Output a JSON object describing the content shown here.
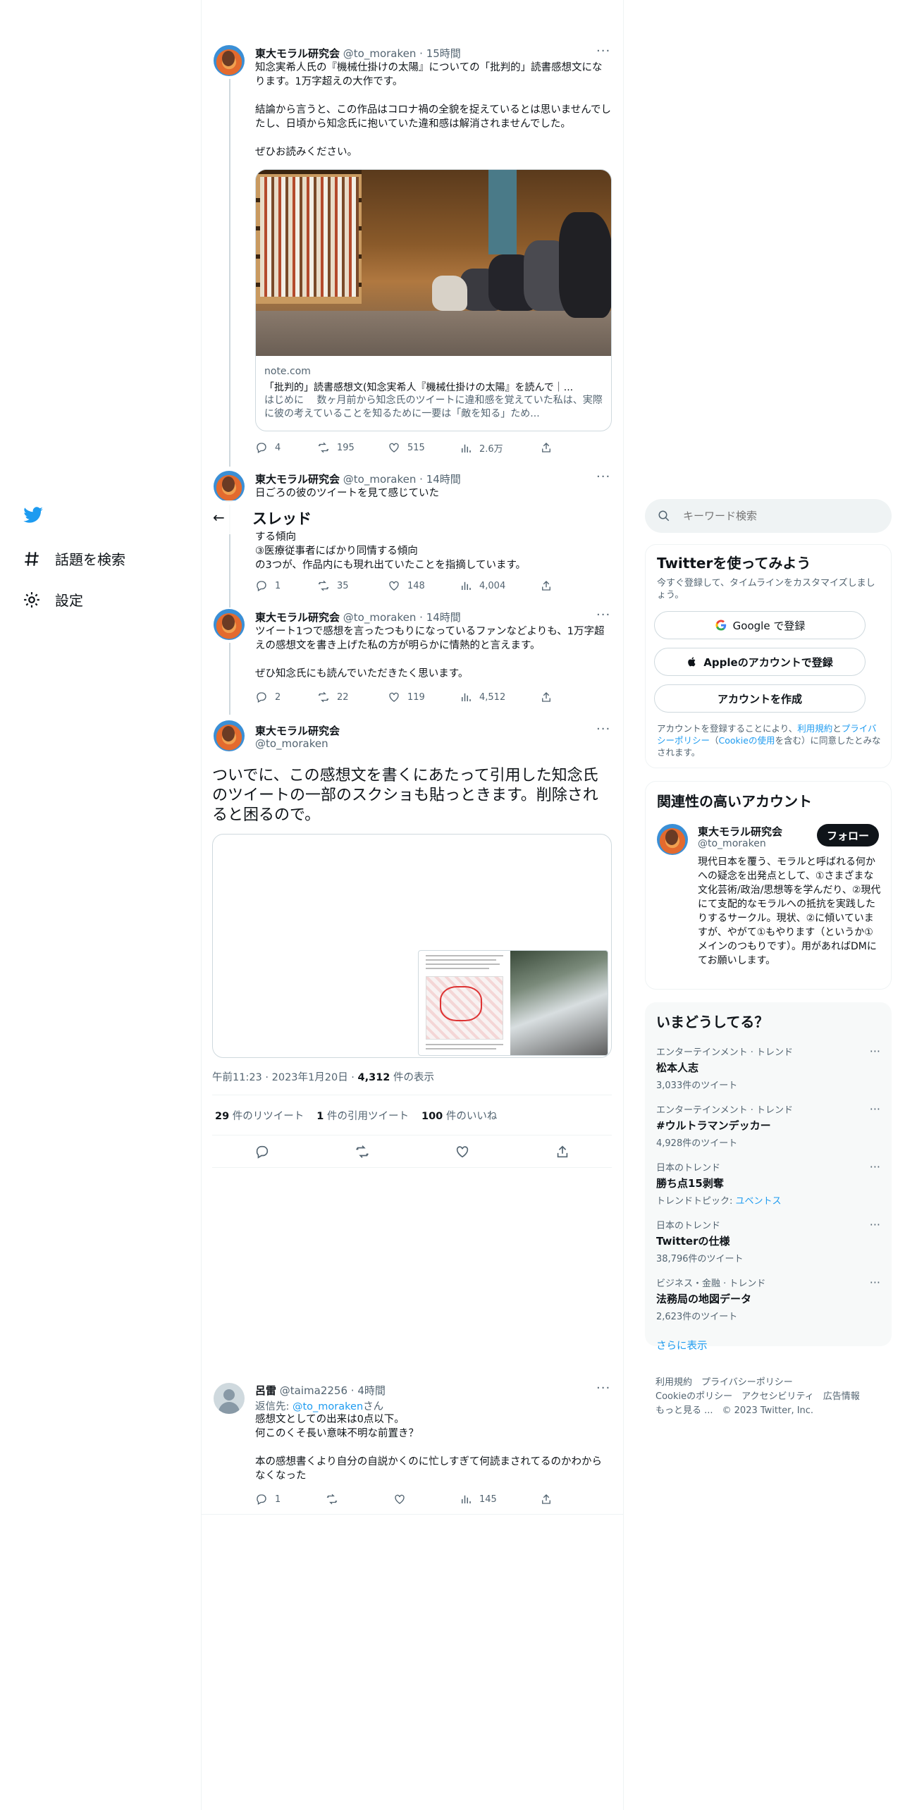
{
  "nav": {
    "explore": "話題を検索",
    "settings": "設定"
  },
  "topbar": {
    "back": "←",
    "title": "スレッド"
  },
  "tweets": [
    {
      "name": "東大モラル研究会",
      "handle": "@to_moraken",
      "time": "15時間",
      "text": "知念実希人氏の『機械仕掛けの太陽』についての「批判的」読書感想文になります。1万字超えの大作です。\n\n結論から言うと、この作品はコロナ禍の全貌を捉えているとは思いませんでしたし、日頃から知念氏に抱いていた違和感は解消されませんでした。\n\nぜひお読みください。",
      "card": {
        "domain": "note.com",
        "title": "「批判的」読書感想文(知念実希人『機械仕掛けの太陽』を読んで｜...",
        "desc": "はじめに　 数ヶ月前から知念氏のツイートに違和感を覚えていた私は、実際に彼の考えていることを知るために一要は「敵を知る」ため..."
      },
      "replies": "4",
      "retweets": "195",
      "likes": "515",
      "views": "2.6万"
    },
    {
      "name": "東大モラル研究会",
      "handle": "@to_moraken",
      "time": "14時間",
      "text": "日ごろの彼のツイートを見て感じていた",
      "text2": "する傾向\n③医療従事者にばかり同情する傾向\nの3つが、作品内にも現れ出ていたことを指摘しています。",
      "replies": "1",
      "retweets": "35",
      "likes": "148",
      "views": "4,004"
    },
    {
      "name": "東大モラル研究会",
      "handle": "@to_moraken",
      "time": "14時間",
      "text": "ツイート1つで感想を言ったつもりになっているファンなどよりも、1万字超えの感想文を書き上げた私の方が明らかに情熱的と言えます。\n\nぜひ知念氏にも読んでいただきたく思います。",
      "replies": "2",
      "retweets": "22",
      "likes": "119",
      "views": "4,512"
    }
  ],
  "main": {
    "name": "東大モラル研究会",
    "handle": "@to_moraken",
    "text": "ついでに、この感想文を書くにあたって引用した知念氏のツイートの一部のスクショも貼っときます。削除されると困るので。",
    "time": "午前11:23",
    "date": "2023年1月20日",
    "views_num": "4,312",
    "views_label": "件の表示",
    "retweets_num": "29",
    "retweets_label": "件のリツイート",
    "quotes_num": "1",
    "quotes_label": "件の引用ツイート",
    "likes_num": "100",
    "likes_label": "件のいいね"
  },
  "reply": {
    "name": "呂雷",
    "handle": "@taima2256",
    "time": "4時間",
    "reply_to_label": "返信先: ",
    "reply_to_handle": "@to_moraken",
    "reply_to_suffix": "さん",
    "text": "感想文としての出来は0点以下。\n何このくそ長い意味不明な前置き？\n\n本の感想書くより自分の自説かくのに忙しすぎて何読まされてるのかわからなくなった",
    "replies": "1",
    "views": "145"
  },
  "search": {
    "placeholder": "キーワード検索"
  },
  "signup": {
    "title": "Twitterを使ってみよう",
    "sub": "今すぐ登録して、タイムラインをカスタマイズしましょう。",
    "google": "Google で登録",
    "apple": "Appleのアカウントで登録",
    "create": "アカウントを作成",
    "terms_pre": "アカウントを登録することにより、",
    "terms_link": "利用規約",
    "terms_and": "と",
    "privacy_link": "プライバシーポリシー",
    "cookie_pre": "（",
    "cookie_link": "Cookieの使用",
    "terms_post": "を含む）に同意したとみなされます。"
  },
  "related": {
    "title": "関連性の高いアカウント",
    "name": "東大モラル研究会",
    "handle": "@to_moraken",
    "follow": "フォロー",
    "bio": "現代日本を覆う、モラルと呼ばれる何かへの疑念を出発点として、①さまざまな文化芸術/政治/思想等を学んだり、②現代にて支配的なモラルへの抵抗を実践したりするサークル。現状、②に傾いていますが、やがて①もやります（というか①メインのつもりです）。用があればDMにてお願いします。"
  },
  "trends": {
    "title": "いまどうしてる？",
    "items": [
      {
        "category": "エンターテインメント · トレンド",
        "name": "松本人志",
        "count": "3,033件のツイート"
      },
      {
        "category": "エンターテインメント · トレンド",
        "name": "#ウルトラマンデッカー",
        "count": "4,928件のツイート"
      },
      {
        "category": "日本のトレンド",
        "name": "勝ち点15剥奪",
        "count_pre": "トレンドトピック: ",
        "count_link": "ユベントス"
      },
      {
        "category": "日本のトレンド",
        "name": "Twitterの仕様",
        "count": "38,796件のツイート"
      },
      {
        "category": "ビジネス・金融 · トレンド",
        "name": "法務局の地図データ",
        "count": "2,623件のツイート"
      }
    ],
    "more": "さらに表示"
  },
  "footer": {
    "line1": "利用規約　プライバシーポリシー",
    "line2": "Cookieのポリシー　アクセシビリティ　広告情報",
    "line3": "もっと見る ...　© 2023 Twitter, Inc."
  },
  "colors": {
    "accent": "#1d9bf0",
    "text": "#0f1419",
    "muted": "#536471",
    "border": "#eff3f4"
  }
}
